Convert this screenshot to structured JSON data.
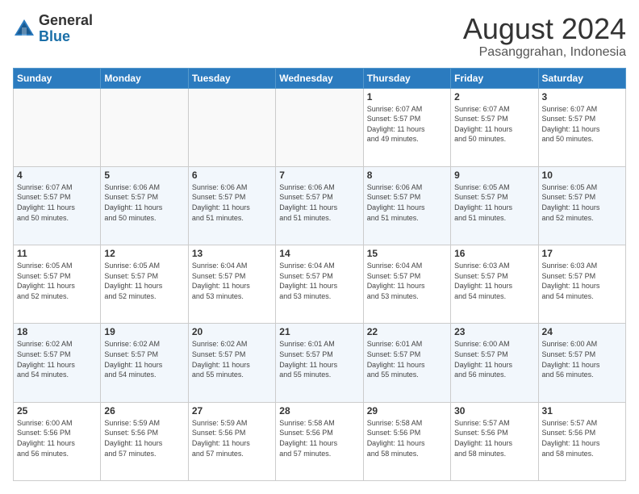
{
  "header": {
    "logo_general": "General",
    "logo_blue": "Blue",
    "month_year": "August 2024",
    "location": "Pasanggrahan, Indonesia"
  },
  "days_of_week": [
    "Sunday",
    "Monday",
    "Tuesday",
    "Wednesday",
    "Thursday",
    "Friday",
    "Saturday"
  ],
  "weeks": [
    [
      {
        "day": "",
        "info": ""
      },
      {
        "day": "",
        "info": ""
      },
      {
        "day": "",
        "info": ""
      },
      {
        "day": "",
        "info": ""
      },
      {
        "day": "1",
        "info": "Sunrise: 6:07 AM\nSunset: 5:57 PM\nDaylight: 11 hours\nand 49 minutes."
      },
      {
        "day": "2",
        "info": "Sunrise: 6:07 AM\nSunset: 5:57 PM\nDaylight: 11 hours\nand 50 minutes."
      },
      {
        "day": "3",
        "info": "Sunrise: 6:07 AM\nSunset: 5:57 PM\nDaylight: 11 hours\nand 50 minutes."
      }
    ],
    [
      {
        "day": "4",
        "info": "Sunrise: 6:07 AM\nSunset: 5:57 PM\nDaylight: 11 hours\nand 50 minutes."
      },
      {
        "day": "5",
        "info": "Sunrise: 6:06 AM\nSunset: 5:57 PM\nDaylight: 11 hours\nand 50 minutes."
      },
      {
        "day": "6",
        "info": "Sunrise: 6:06 AM\nSunset: 5:57 PM\nDaylight: 11 hours\nand 51 minutes."
      },
      {
        "day": "7",
        "info": "Sunrise: 6:06 AM\nSunset: 5:57 PM\nDaylight: 11 hours\nand 51 minutes."
      },
      {
        "day": "8",
        "info": "Sunrise: 6:06 AM\nSunset: 5:57 PM\nDaylight: 11 hours\nand 51 minutes."
      },
      {
        "day": "9",
        "info": "Sunrise: 6:05 AM\nSunset: 5:57 PM\nDaylight: 11 hours\nand 51 minutes."
      },
      {
        "day": "10",
        "info": "Sunrise: 6:05 AM\nSunset: 5:57 PM\nDaylight: 11 hours\nand 52 minutes."
      }
    ],
    [
      {
        "day": "11",
        "info": "Sunrise: 6:05 AM\nSunset: 5:57 PM\nDaylight: 11 hours\nand 52 minutes."
      },
      {
        "day": "12",
        "info": "Sunrise: 6:05 AM\nSunset: 5:57 PM\nDaylight: 11 hours\nand 52 minutes."
      },
      {
        "day": "13",
        "info": "Sunrise: 6:04 AM\nSunset: 5:57 PM\nDaylight: 11 hours\nand 53 minutes."
      },
      {
        "day": "14",
        "info": "Sunrise: 6:04 AM\nSunset: 5:57 PM\nDaylight: 11 hours\nand 53 minutes."
      },
      {
        "day": "15",
        "info": "Sunrise: 6:04 AM\nSunset: 5:57 PM\nDaylight: 11 hours\nand 53 minutes."
      },
      {
        "day": "16",
        "info": "Sunrise: 6:03 AM\nSunset: 5:57 PM\nDaylight: 11 hours\nand 54 minutes."
      },
      {
        "day": "17",
        "info": "Sunrise: 6:03 AM\nSunset: 5:57 PM\nDaylight: 11 hours\nand 54 minutes."
      }
    ],
    [
      {
        "day": "18",
        "info": "Sunrise: 6:02 AM\nSunset: 5:57 PM\nDaylight: 11 hours\nand 54 minutes."
      },
      {
        "day": "19",
        "info": "Sunrise: 6:02 AM\nSunset: 5:57 PM\nDaylight: 11 hours\nand 54 minutes."
      },
      {
        "day": "20",
        "info": "Sunrise: 6:02 AM\nSunset: 5:57 PM\nDaylight: 11 hours\nand 55 minutes."
      },
      {
        "day": "21",
        "info": "Sunrise: 6:01 AM\nSunset: 5:57 PM\nDaylight: 11 hours\nand 55 minutes."
      },
      {
        "day": "22",
        "info": "Sunrise: 6:01 AM\nSunset: 5:57 PM\nDaylight: 11 hours\nand 55 minutes."
      },
      {
        "day": "23",
        "info": "Sunrise: 6:00 AM\nSunset: 5:57 PM\nDaylight: 11 hours\nand 56 minutes."
      },
      {
        "day": "24",
        "info": "Sunrise: 6:00 AM\nSunset: 5:57 PM\nDaylight: 11 hours\nand 56 minutes."
      }
    ],
    [
      {
        "day": "25",
        "info": "Sunrise: 6:00 AM\nSunset: 5:56 PM\nDaylight: 11 hours\nand 56 minutes."
      },
      {
        "day": "26",
        "info": "Sunrise: 5:59 AM\nSunset: 5:56 PM\nDaylight: 11 hours\nand 57 minutes."
      },
      {
        "day": "27",
        "info": "Sunrise: 5:59 AM\nSunset: 5:56 PM\nDaylight: 11 hours\nand 57 minutes."
      },
      {
        "day": "28",
        "info": "Sunrise: 5:58 AM\nSunset: 5:56 PM\nDaylight: 11 hours\nand 57 minutes."
      },
      {
        "day": "29",
        "info": "Sunrise: 5:58 AM\nSunset: 5:56 PM\nDaylight: 11 hours\nand 58 minutes."
      },
      {
        "day": "30",
        "info": "Sunrise: 5:57 AM\nSunset: 5:56 PM\nDaylight: 11 hours\nand 58 minutes."
      },
      {
        "day": "31",
        "info": "Sunrise: 5:57 AM\nSunset: 5:56 PM\nDaylight: 11 hours\nand 58 minutes."
      }
    ]
  ]
}
